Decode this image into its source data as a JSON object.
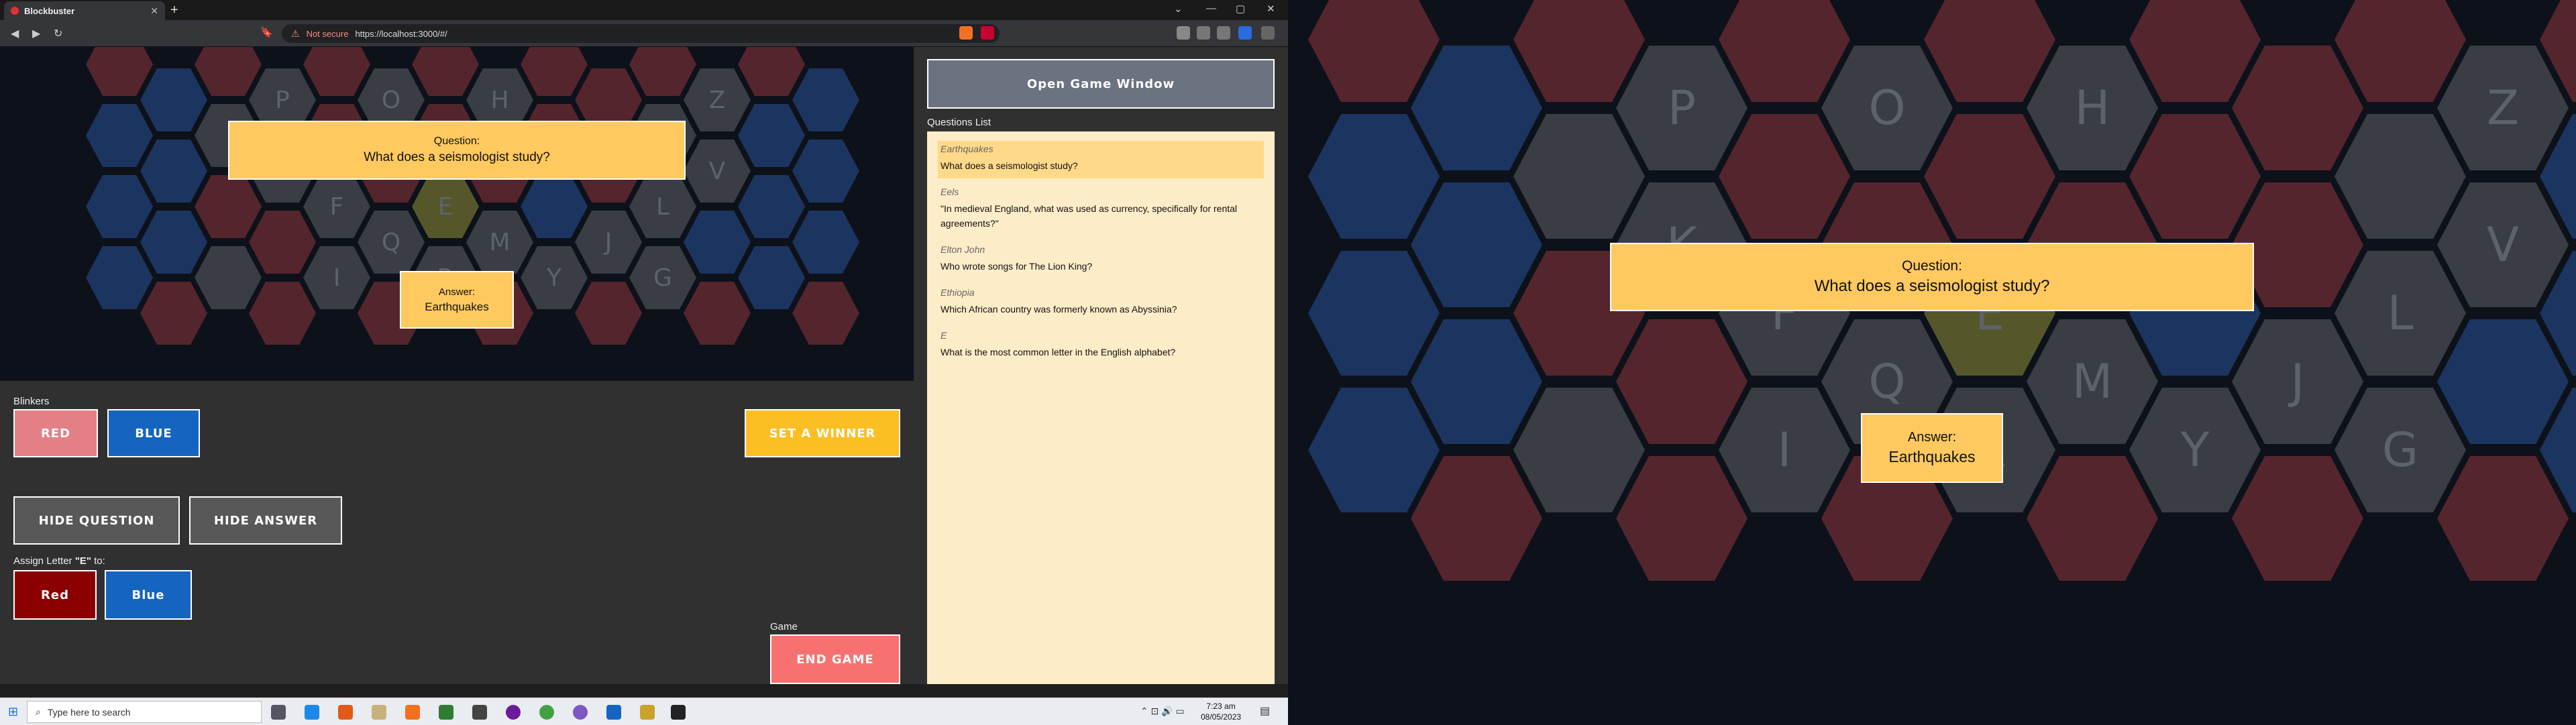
{
  "browser": {
    "tab_title": "Blockbuster",
    "new_tab": "+",
    "not_secure": "Not secure",
    "url": "https://localhost:3000/#/"
  },
  "board_letters": [
    "P",
    "O",
    "H",
    "Z",
    "K",
    "V",
    "F",
    "E",
    "L",
    "Q",
    "M",
    "J",
    "I",
    "R",
    "Y",
    "G"
  ],
  "question_box": {
    "label": "Question:",
    "text": "What does a seismologist study?"
  },
  "answer_box": {
    "label": "Answer:",
    "text": "Earthquakes"
  },
  "controls": {
    "blinkers_label": "Blinkers",
    "red_label": "RED",
    "blue_label": "BLUE",
    "set_winner_label": "SET A WINNER",
    "hide_question_label": "HIDE QUESTION",
    "hide_answer_label": "HIDE ANSWER",
    "assign_prefix": "Assign Letter ",
    "assign_letter": "\"E\"",
    "assign_suffix": " to:",
    "assign_red": "Red",
    "assign_blue": "Blue",
    "game_label": "Game",
    "end_game_label": "END GAME"
  },
  "side": {
    "open_game_window": "Open Game Window",
    "questions_list_label": "Questions List",
    "questions": [
      {
        "answer": "Earthquakes",
        "question": "What does a seismologist study?",
        "selected": true
      },
      {
        "answer": "Eels",
        "question": "\"In medieval England, what was used as currency, specifically for rental agreements?\"",
        "selected": false
      },
      {
        "answer": "Elton John",
        "question": "Who wrote songs for The Lion King?",
        "selected": false
      },
      {
        "answer": "Ethiopia",
        "question": "Which African country was formerly known as Abyssinia?",
        "selected": false
      },
      {
        "answer": "E",
        "question": "What is the most common letter in the English alphabet?",
        "selected": false
      }
    ]
  },
  "taskbar": {
    "search_placeholder": "Type here to search",
    "time": "7:23 am",
    "date": "08/05/2023"
  },
  "colors": {
    "red_team": "#8b0000",
    "blue_team": "#1565c0",
    "gold": "#ffc95f",
    "end_game": "#f87171"
  }
}
